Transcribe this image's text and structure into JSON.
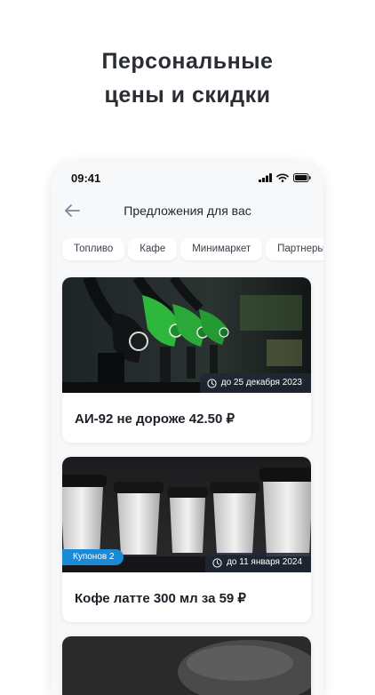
{
  "headline": {
    "line1": "Персональные",
    "line2": "цены и скидки"
  },
  "status_bar": {
    "time": "09:41"
  },
  "nav": {
    "title": "Предложения для вас"
  },
  "chips": [
    "Топливо",
    "Кафе",
    "Минимаркет",
    "Партнеры"
  ],
  "offers": [
    {
      "title": "АИ-92 не дороже 42.50 ₽",
      "date": "до 25 декабря 2023",
      "coupon": ""
    },
    {
      "title": "Кофе латте 300 мл за 59 ₽",
      "date": "до 11 января 2024",
      "coupon": "Купонов 2"
    }
  ],
  "icons": {
    "back": "arrow-left-icon",
    "clock": "clock-icon",
    "signal": "signal-icon",
    "wifi": "wifi-icon",
    "battery": "battery-icon"
  },
  "colors": {
    "accent": "#1a8ad6",
    "pump_green": "#2db83d"
  }
}
